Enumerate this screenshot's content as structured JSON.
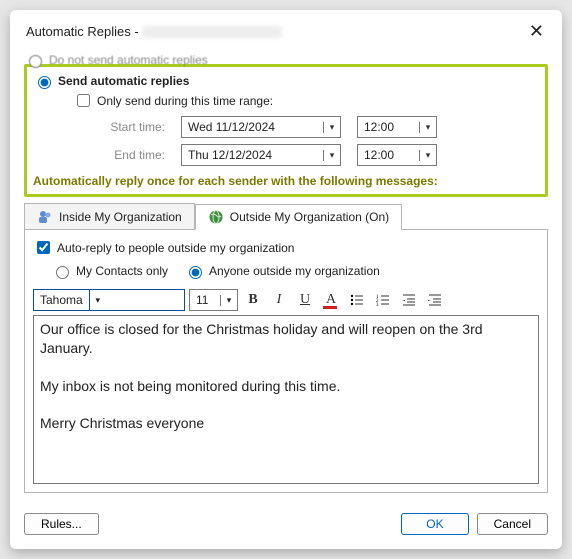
{
  "title_prefix": "Automatic Replies - ",
  "opt_do_not_send": "Do not send automatic replies",
  "opt_send": "Send automatic replies",
  "chk_only_range": "Only send during this time range:",
  "lbl_start": "Start time:",
  "lbl_end": "End time:",
  "start_date": "Wed 11/12/2024",
  "start_time": "12:00",
  "end_date": "Thu 12/12/2024",
  "end_time": "12:00",
  "info_line": "Automatically reply once for each sender with the following messages:",
  "tabs": {
    "inside": "Inside My Organization",
    "outside": "Outside My Organization (On)"
  },
  "chk_auto_outside": "Auto-reply to people outside my organization",
  "opt_contacts_only": "My Contacts only",
  "opt_anyone": "Anyone outside my organization",
  "font_name": "Tahoma",
  "font_size": "11",
  "message_body": "Our office is closed for the Christmas holiday and will reopen on the 3rd January.\n\nMy inbox is not being monitored during this time.\n\nMerry Christmas everyone",
  "btn_rules": "Rules...",
  "btn_ok": "OK",
  "btn_cancel": "Cancel"
}
